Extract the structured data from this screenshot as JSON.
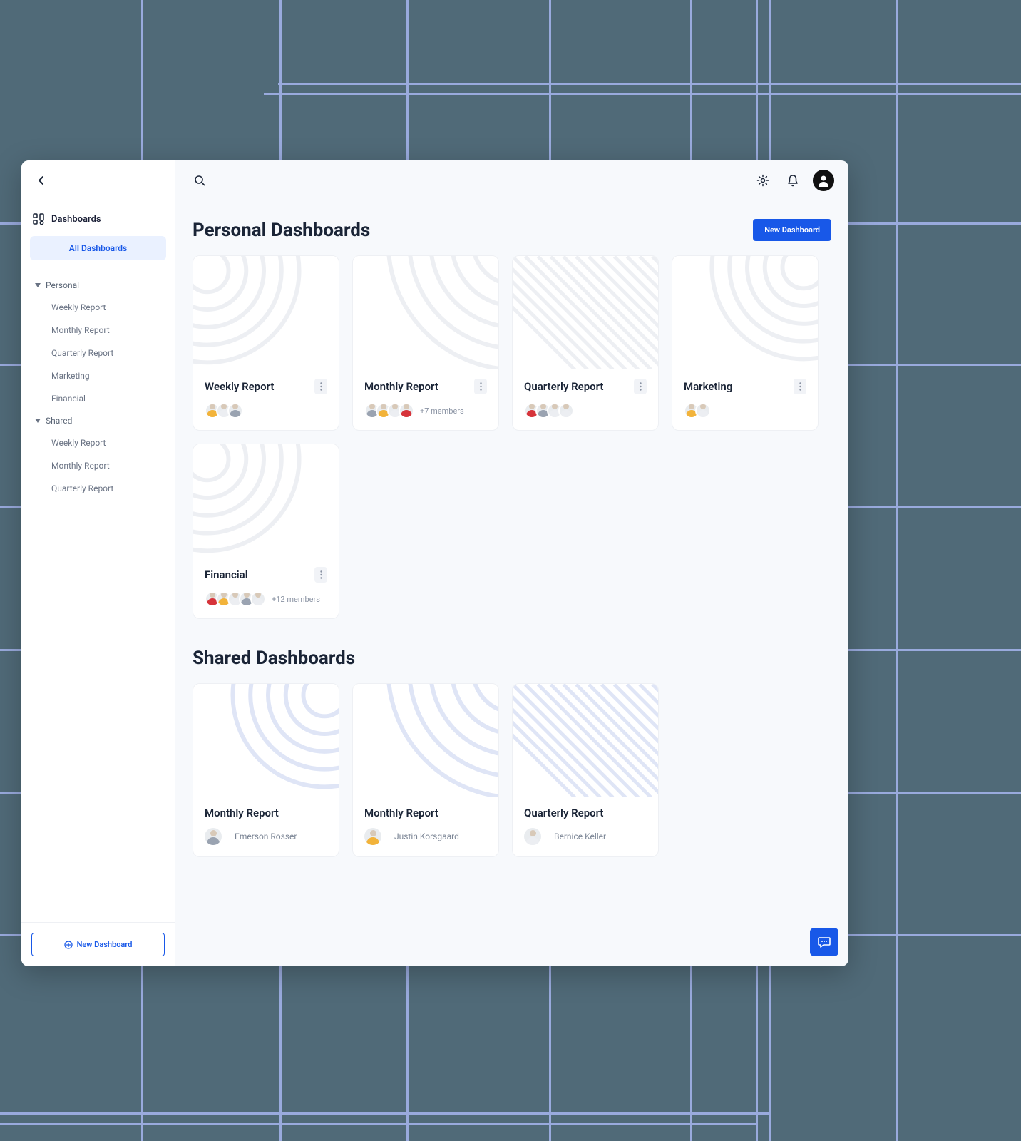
{
  "sidebar": {
    "header_label": "Dashboards",
    "active_label": "All Dashboards",
    "groups": [
      {
        "label": "Personal",
        "items": [
          "Weekly Report",
          "Monthly Report",
          "Quarterly Report",
          "Marketing",
          "Financial"
        ]
      },
      {
        "label": "Shared",
        "items": [
          "Weekly Report",
          "Monthly Report",
          "Quarterly Report"
        ]
      }
    ],
    "new_button": "New Dashboard"
  },
  "topbar": {
    "new_button": "New Dashboard"
  },
  "sections": {
    "personal": {
      "title": "Personal Dashboards",
      "cards": [
        {
          "title": "Weekly Report",
          "pattern": "rings-tl",
          "stroke": "#edeff3",
          "avatars": [
            "yellow",
            "white",
            "grey"
          ],
          "extra": ""
        },
        {
          "title": "Monthly Report",
          "pattern": "arcs-tr",
          "stroke": "#edeff3",
          "avatars": [
            "grey",
            "yellow",
            "white",
            "red"
          ],
          "extra": "+7 members"
        },
        {
          "title": "Quarterly Report",
          "pattern": "diag",
          "stroke": "#edeff3",
          "avatars": [
            "red",
            "grey",
            "white",
            "white"
          ],
          "extra": ""
        },
        {
          "title": "Marketing",
          "pattern": "rings-tr",
          "stroke": "#edeff3",
          "avatars": [
            "yellow",
            "white"
          ],
          "extra": ""
        },
        {
          "title": "Financial",
          "pattern": "rings-tl",
          "stroke": "#edeff3",
          "avatars": [
            "red",
            "yellow",
            "white",
            "grey",
            "white"
          ],
          "extra": "+12 members"
        }
      ]
    },
    "shared": {
      "title": "Shared Dashboards",
      "cards": [
        {
          "title": "Monthly Report",
          "pattern": "rings-tr",
          "stroke": "#dfe5f6",
          "owner": "Emerson Rosser",
          "owner_color": "grey"
        },
        {
          "title": "Monthly Report",
          "pattern": "arcs-tr",
          "stroke": "#dfe5f6",
          "owner": "Justin Korsgaard",
          "owner_color": "yellow"
        },
        {
          "title": "Quarterly Report",
          "pattern": "diag",
          "stroke": "#dfe5f6",
          "owner": "Bernice Keller",
          "owner_color": "white"
        }
      ]
    }
  }
}
